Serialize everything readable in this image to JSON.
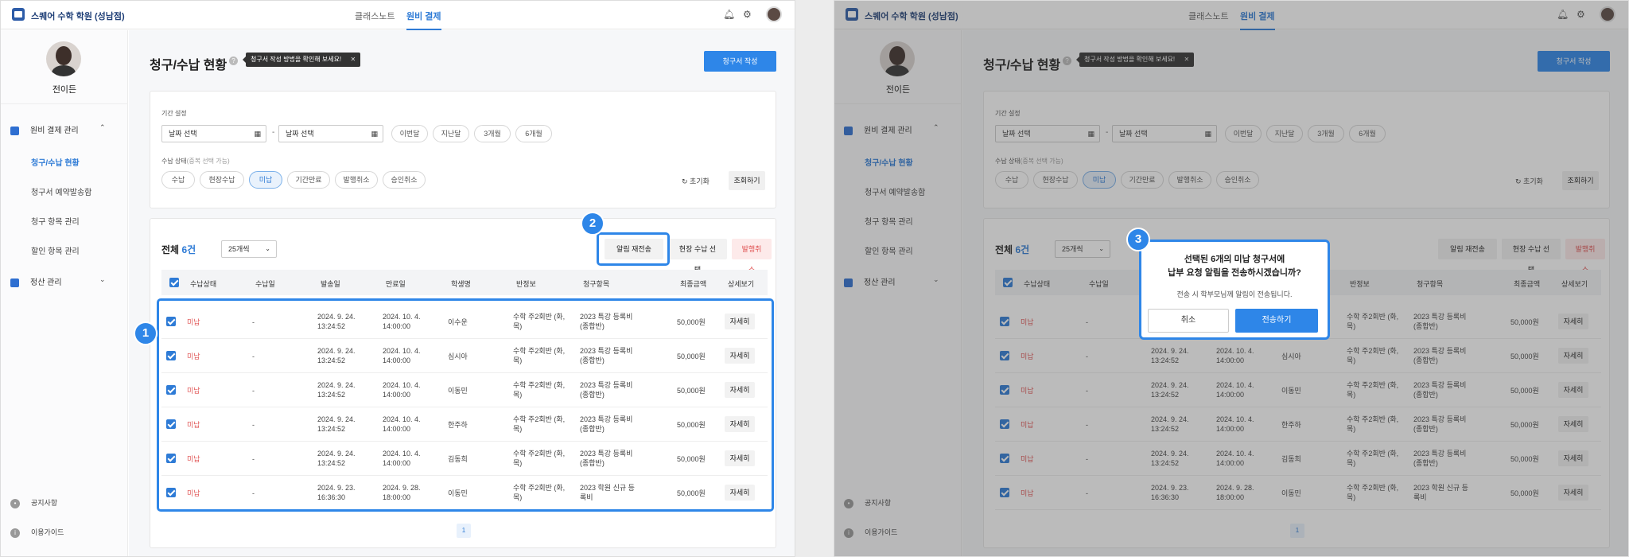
{
  "header": {
    "brand": "스퀘어 수학 학원 (성남점)",
    "nav": [
      "클래스노트",
      "원비 결제"
    ],
    "active_nav": "원비 결제",
    "icons": [
      "bell-icon",
      "gear-icon",
      "avatar"
    ]
  },
  "sidebar": {
    "user_name": "전이든",
    "group1": "원비 결제 관리",
    "items": [
      "청구/수납 현황",
      "청구서 예약발송함",
      "청구 항목 관리",
      "할인 항목 관리"
    ],
    "group2": "정산 관리",
    "bottom": [
      "공지사항",
      "이용가이드"
    ]
  },
  "page": {
    "title": "청구/수납 현황",
    "tooltip": "청구서 작성 방법을 확인해 보세요!",
    "create_button": "청구서 작성"
  },
  "filter": {
    "period_label": "기간 설정",
    "date_placeholder": "날짜 선택",
    "dash": "-",
    "period_buttons": [
      "이번달",
      "지난달",
      "3개월",
      "6개월"
    ],
    "status_label": "수납 상태",
    "status_hint": "(중복 선택 가능)",
    "status_buttons": [
      "수납",
      "현장수납",
      "미납",
      "기간만료",
      "발행취소",
      "승인취소"
    ],
    "selected_status": "미납",
    "reset": "초기화",
    "search": "조회하기"
  },
  "list": {
    "total_label": "전체",
    "total_count": "6건",
    "page_size": "25개씩",
    "actions": [
      "알림 재전송",
      "현장 수납 선택",
      "발행취소"
    ],
    "columns": [
      "수납상태",
      "수납일",
      "발송일",
      "만료일",
      "학생명",
      "반정보",
      "청구항목",
      "최종금액",
      "상세보기"
    ],
    "rows": [
      {
        "status": "미납",
        "paid": "-",
        "sent1": "2024. 9. 24.",
        "sent2": "13:24:52",
        "exp1": "2024. 10. 4.",
        "exp2": "14:00:00",
        "student": "이수운",
        "class1": "수학 주2회반 (화,",
        "class2": "목)",
        "item1": "2023 특강 등록비",
        "item2": "(종합반)",
        "amount": "50,000원",
        "detail": "자세히"
      },
      {
        "status": "미납",
        "paid": "-",
        "sent1": "2024. 9. 24.",
        "sent2": "13:24:52",
        "exp1": "2024. 10. 4.",
        "exp2": "14:00:00",
        "student": "심시아",
        "class1": "수학 주2회반 (화,",
        "class2": "목)",
        "item1": "2023 특강 등록비",
        "item2": "(종합반)",
        "amount": "50,000원",
        "detail": "자세히"
      },
      {
        "status": "미납",
        "paid": "-",
        "sent1": "2024. 9. 24.",
        "sent2": "13:24:52",
        "exp1": "2024. 10. 4.",
        "exp2": "14:00:00",
        "student": "이동민",
        "class1": "수학 주2회반 (화,",
        "class2": "목)",
        "item1": "2023 특강 등록비",
        "item2": "(종합반)",
        "amount": "50,000원",
        "detail": "자세히"
      },
      {
        "status": "미납",
        "paid": "-",
        "sent1": "2024. 9. 24.",
        "sent2": "13:24:52",
        "exp1": "2024. 10. 4.",
        "exp2": "14:00:00",
        "student": "한주하",
        "class1": "수학 주2회반 (화,",
        "class2": "목)",
        "item1": "2023 특강 등록비",
        "item2": "(종합반)",
        "amount": "50,000원",
        "detail": "자세히"
      },
      {
        "status": "미납",
        "paid": "-",
        "sent1": "2024. 9. 24.",
        "sent2": "13:24:52",
        "exp1": "2024. 10. 4.",
        "exp2": "14:00:00",
        "student": "김동희",
        "class1": "수학 주2회반 (화,",
        "class2": "목)",
        "item1": "2023 특강 등록비",
        "item2": "(종합반)",
        "amount": "50,000원",
        "detail": "자세히"
      },
      {
        "status": "미납",
        "paid": "-",
        "sent1": "2024. 9. 23.",
        "sent2": "16:36:30",
        "exp1": "2024. 9. 28.",
        "exp2": "18:00:00",
        "student": "이동민",
        "class1": "수학 주2회반 (화,",
        "class2": "목)",
        "item1": "2023 학원 신규 등",
        "item2": "록비",
        "amount": "50,000원",
        "detail": "자세히"
      }
    ],
    "page_number": "1"
  },
  "steps": [
    "1",
    "2",
    "3"
  ],
  "modal": {
    "title_line1": "선택된 6개의 미납 청구서에",
    "title_line2": "납부 요청 알림을 전송하시겠습니까?",
    "subtitle": "전송 시 학부모님께 알림이 전송됩니다.",
    "cancel": "취소",
    "confirm": "전송하기"
  },
  "colors": {
    "accent": "#2e86e8",
    "unpaid": "#e05252",
    "brand": "#1f3f77"
  }
}
